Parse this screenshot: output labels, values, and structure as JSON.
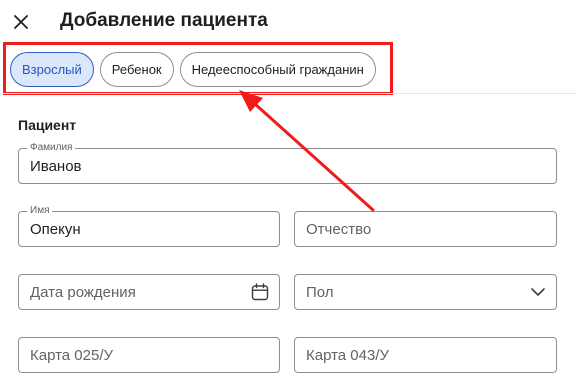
{
  "header": {
    "title": "Добавление пациента"
  },
  "tabs": [
    {
      "label": "Взрослый",
      "active": true
    },
    {
      "label": "Ребенок",
      "active": false
    },
    {
      "label": "Недееспособный гражданин",
      "active": false
    }
  ],
  "section": {
    "title": "Пациент"
  },
  "form": {
    "last_name": {
      "label": "Фамилия",
      "value": "Иванов"
    },
    "first_name": {
      "label": "Имя",
      "value": "Опекун"
    },
    "middle_name": {
      "placeholder": "Отчество"
    },
    "birth_date": {
      "placeholder": "Дата рождения",
      "icon": "calendar-icon"
    },
    "gender": {
      "placeholder": "Пол",
      "icon": "chevron-down-icon"
    },
    "card_025": {
      "placeholder": "Карта 025/У"
    },
    "card_043": {
      "placeholder": "Карта 043/У"
    }
  },
  "colors": {
    "active_tab_bg": "#dbe7fb",
    "active_tab_text": "#2456c2",
    "annotation_red": "#ee1c1c",
    "border": "#8a8f98"
  }
}
